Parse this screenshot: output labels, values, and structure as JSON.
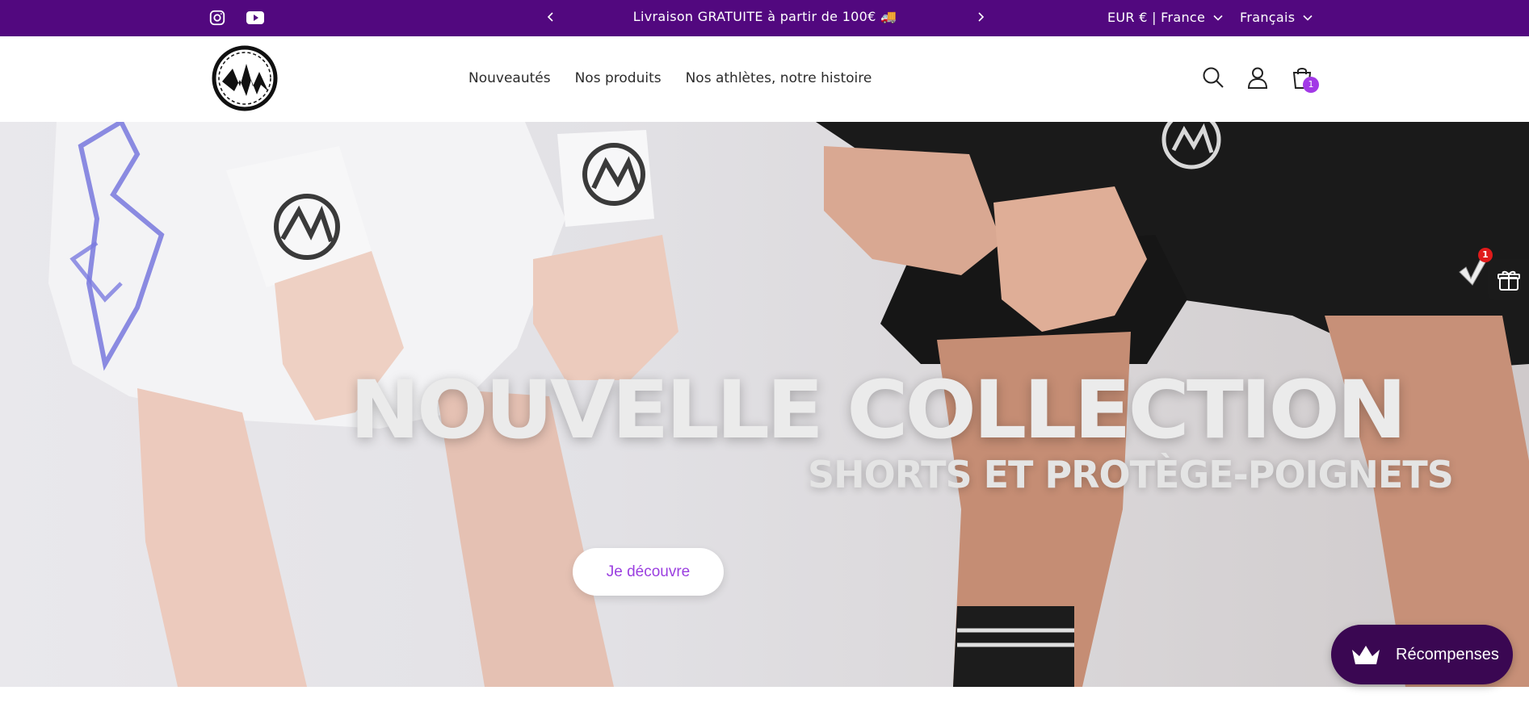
{
  "announcement": {
    "text": "Livraison GRATUITE à partir de 100€ 🚚",
    "country_selector": "EUR € | France",
    "language_selector": "Français",
    "social": [
      "instagram-icon",
      "youtube-icon"
    ]
  },
  "header": {
    "nav": [
      "Nouveautés",
      "Nos produits",
      "Nos athlètes, notre histoire"
    ],
    "cart_count": "1"
  },
  "hero": {
    "title": "NOUVELLE COLLECTION",
    "subtitle": "SHORTS ET PROTÈGE-POIGNETS",
    "button": "Je découvre"
  },
  "widgets": {
    "gift_badge": "1",
    "rewards_label": "Récompenses"
  },
  "colors": {
    "announcement_bg": "#52087f",
    "accent": "#a239e6",
    "rewards_bg": "#3a0752"
  }
}
